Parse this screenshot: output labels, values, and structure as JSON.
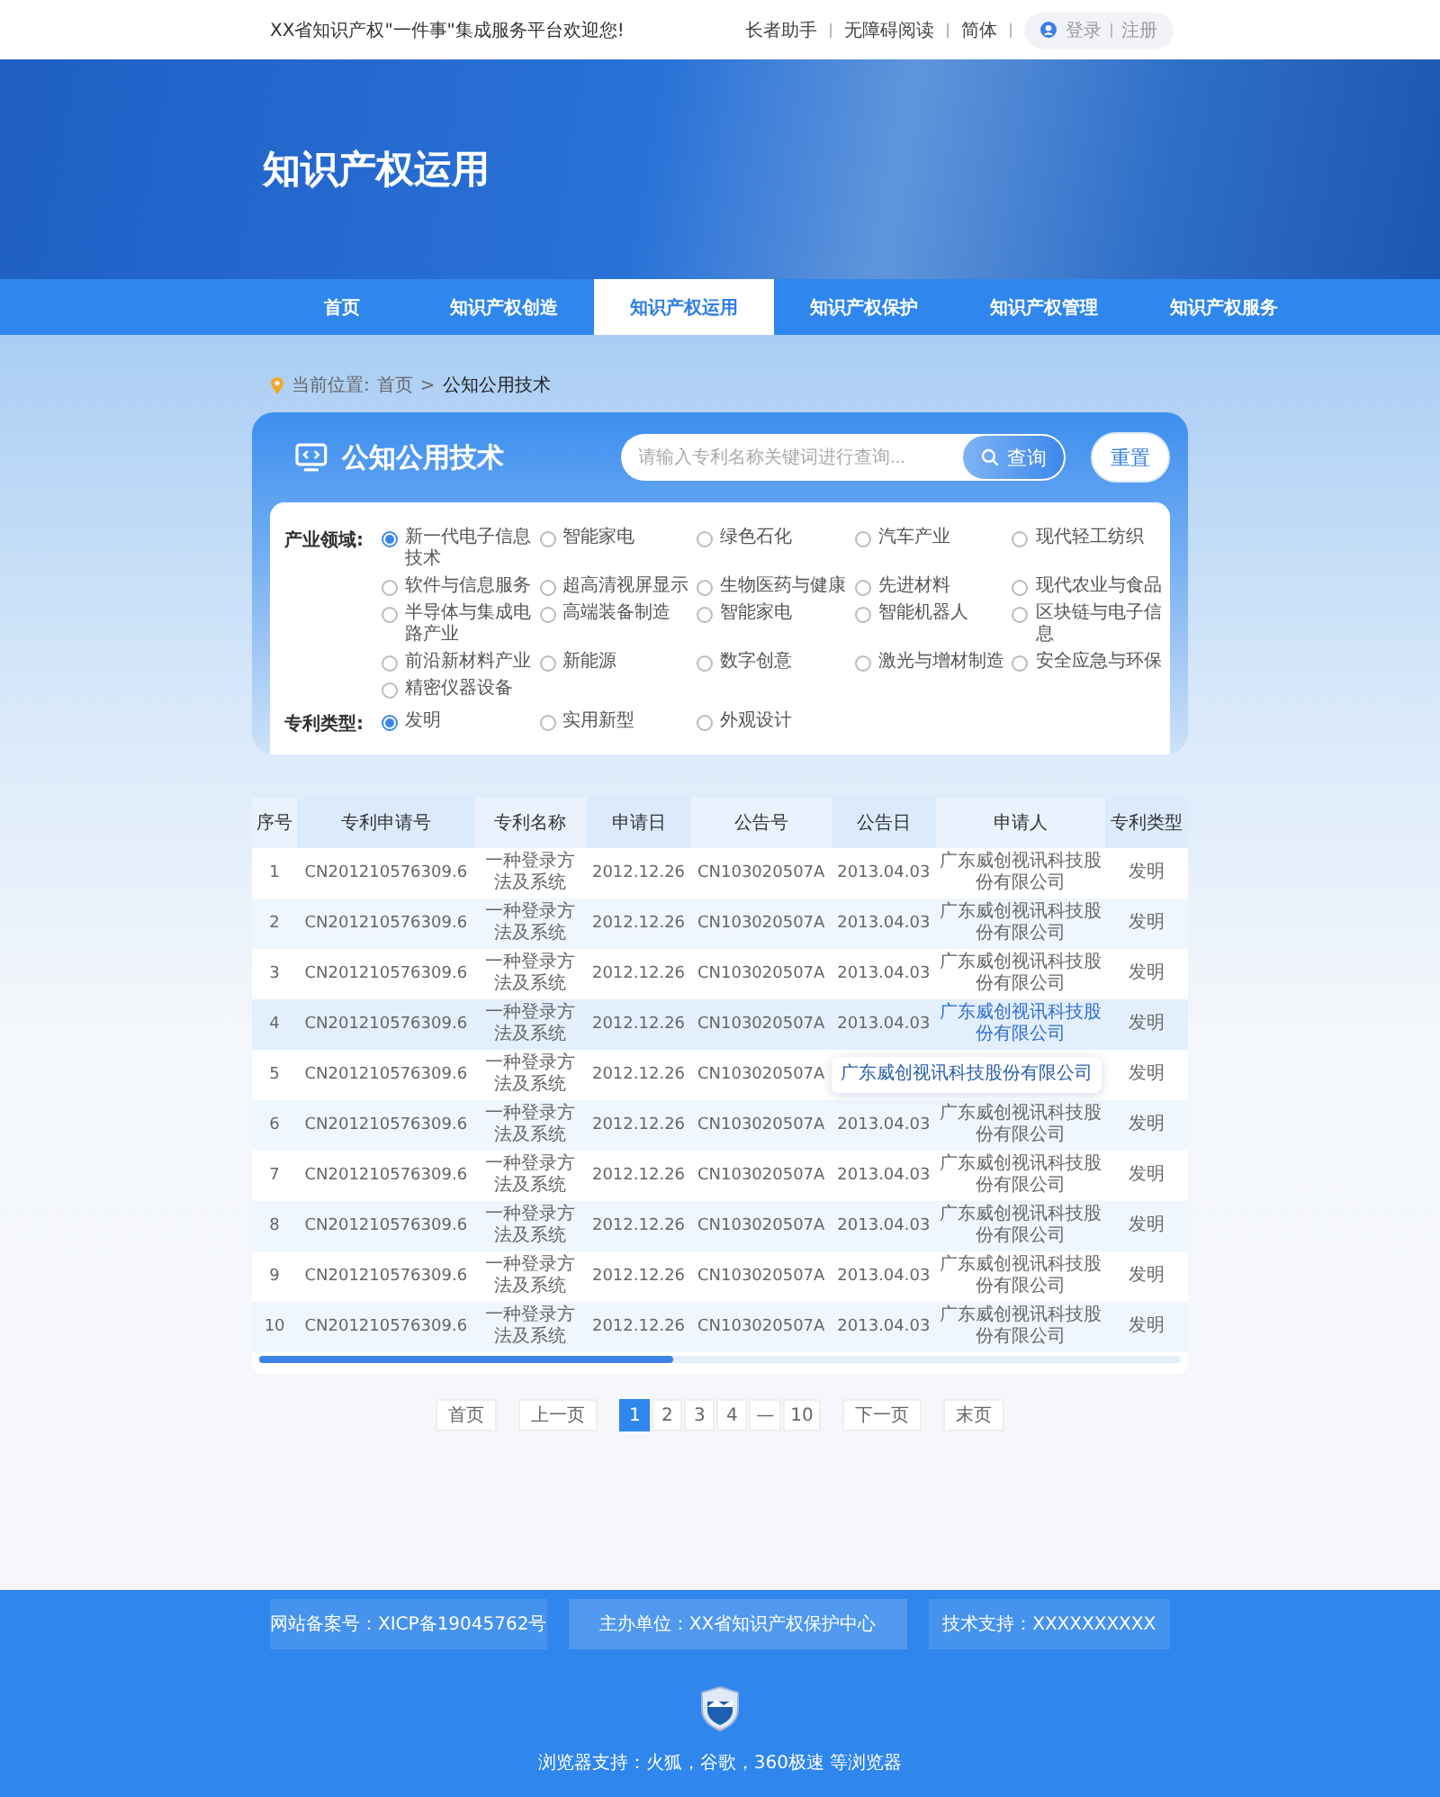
{
  "top_bar": {
    "welcome": "XX省知识产权\"一件事\"集成服务平台欢迎您!",
    "links": [
      "长者助手",
      "无障碍阅读",
      "简体"
    ],
    "login": "登录",
    "register": "注册"
  },
  "banner": {
    "title": "知识产权运用"
  },
  "nav": [
    {
      "label": "首页",
      "selected": false
    },
    {
      "label": "知识产权创造",
      "selected": false
    },
    {
      "label": "知识产权运用",
      "selected": true
    },
    {
      "label": "知识产权保护",
      "selected": false
    },
    {
      "label": "知识产权管理",
      "selected": false
    },
    {
      "label": "知识产权服务",
      "selected": false
    }
  ],
  "breadcrumb": {
    "label": "当前位置:",
    "items": [
      "首页",
      "公知公用技术"
    ],
    "separator": ">"
  },
  "panel": {
    "title": "公知公用技术",
    "search": {
      "placeholder": "请输入专利名称关键词进行查询..."
    },
    "search_button": "查询",
    "reset_button": "重置"
  },
  "filters": [
    {
      "label": "产业领域:",
      "options": [
        {
          "label": "新一代电子信息技术",
          "selected": true
        },
        {
          "label": "智能家电",
          "selected": false
        },
        {
          "label": "绿色石化",
          "selected": false
        },
        {
          "label": "汽车产业",
          "selected": false
        },
        {
          "label": "现代轻工纺织",
          "selected": false
        },
        {
          "label": "软件与信息服务",
          "selected": false
        },
        {
          "label": "超高清视屏显示",
          "selected": false
        },
        {
          "label": "生物医药与健康",
          "selected": false
        },
        {
          "label": "先进材料",
          "selected": false
        },
        {
          "label": "现代农业与食品",
          "selected": false
        },
        {
          "label": "半导体与集成电路产业",
          "selected": false
        },
        {
          "label": "高端装备制造",
          "selected": false
        },
        {
          "label": "智能家电",
          "selected": false
        },
        {
          "label": "智能机器人",
          "selected": false
        },
        {
          "label": "区块链与电子信息",
          "selected": false
        },
        {
          "label": "前沿新材料产业",
          "selected": false
        },
        {
          "label": "新能源",
          "selected": false
        },
        {
          "label": "数字创意",
          "selected": false
        },
        {
          "label": "激光与增材制造",
          "selected": false
        },
        {
          "label": "安全应急与环保",
          "selected": false
        },
        {
          "label": "精密仪器设备",
          "selected": false
        }
      ]
    },
    {
      "label": "专利类型:",
      "options": [
        {
          "label": "发明",
          "selected": true
        },
        {
          "label": "实用新型",
          "selected": false
        },
        {
          "label": "外观设计",
          "selected": false
        }
      ]
    }
  ],
  "table": {
    "columns": [
      "序号",
      "专利申请号",
      "专利名称",
      "申请日",
      "公告号",
      "公告日",
      "申请人",
      "专利类型"
    ],
    "rows": [
      {
        "no": "1",
        "application_no": "CN201210576309.6",
        "title": "一种登录方法及系统",
        "filing_date": "2012.12.26",
        "publication_no": "CN103020507A",
        "publication_date": "2013.04.03",
        "applicant": "广东威创视讯科技股份有限公司",
        "type": "发明",
        "hovered": false
      },
      {
        "no": "2",
        "application_no": "CN201210576309.6",
        "title": "一种登录方法及系统",
        "filing_date": "2012.12.26",
        "publication_no": "CN103020507A",
        "publication_date": "2013.04.03",
        "applicant": "广东威创视讯科技股份有限公司",
        "type": "发明",
        "hovered": false
      },
      {
        "no": "3",
        "application_no": "CN201210576309.6",
        "title": "一种登录方法及系统",
        "filing_date": "2012.12.26",
        "publication_no": "CN103020507A",
        "publication_date": "2013.04.03",
        "applicant": "广东威创视讯科技股份有限公司",
        "type": "发明",
        "hovered": false
      },
      {
        "no": "4",
        "application_no": "CN201210576309.6",
        "title": "一种登录方法及系统",
        "filing_date": "2012.12.26",
        "publication_no": "CN103020507A",
        "publication_date": "2013.04.03",
        "applicant": "广东威创视讯科技股份有限公司",
        "type": "发明",
        "hovered": true
      },
      {
        "no": "5",
        "application_no": "CN201210576309.6",
        "title": "一种登录方法及系统",
        "filing_date": "2012.12.26",
        "publication_no": "CN103020507A",
        "type": "发明",
        "hovered": false,
        "tooltip": "广东威创视讯科技股份有限公司"
      },
      {
        "no": "6",
        "application_no": "CN201210576309.6",
        "title": "一种登录方法及系统",
        "filing_date": "2012.12.26",
        "publication_no": "CN103020507A",
        "publication_date": "2013.04.03",
        "applicant": "广东威创视讯科技股份有限公司",
        "type": "发明",
        "hovered": false
      },
      {
        "no": "7",
        "application_no": "CN201210576309.6",
        "title": "一种登录方法及系统",
        "filing_date": "2012.12.26",
        "publication_no": "CN103020507A",
        "publication_date": "2013.04.03",
        "applicant": "广东威创视讯科技股份有限公司",
        "type": "发明",
        "hovered": false
      },
      {
        "no": "8",
        "application_no": "CN201210576309.6",
        "title": "一种登录方法及系统",
        "filing_date": "2012.12.26",
        "publication_no": "CN103020507A",
        "publication_date": "2013.04.03",
        "applicant": "广东威创视讯科技股份有限公司",
        "type": "发明",
        "hovered": false
      },
      {
        "no": "9",
        "application_no": "CN201210576309.6",
        "title": "一种登录方法及系统",
        "filing_date": "2012.12.26",
        "publication_no": "CN103020507A",
        "publication_date": "2013.04.03",
        "applicant": "广东威创视讯科技股份有限公司",
        "type": "发明",
        "hovered": false
      },
      {
        "no": "10",
        "application_no": "CN201210576309.6",
        "title": "一种登录方法及系统",
        "filing_date": "2012.12.26",
        "publication_no": "CN103020507A",
        "publication_date": "2013.04.03",
        "applicant": "广东威创视讯科技股份有限公司",
        "type": "发明",
        "hovered": false
      }
    ]
  },
  "pagination": {
    "first": "首页",
    "prev": "上一页",
    "pages": [
      {
        "label": "1",
        "selected": true
      },
      {
        "label": "2",
        "selected": false
      },
      {
        "label": "3",
        "selected": false
      },
      {
        "label": "4",
        "selected": false
      },
      {
        "label": "—",
        "selected": false
      },
      {
        "label": "10",
        "selected": false
      }
    ],
    "next": "下一页",
    "last": "末页"
  },
  "footer": {
    "items": [
      "网站备案号：XICP备19045762号",
      "主办单位：XX省知识产权保护中心",
      "技术支持：XXXXXXXXXX"
    ],
    "browser_note": "浏览器支持：火狐，谷歌，360极速 等浏览器"
  }
}
